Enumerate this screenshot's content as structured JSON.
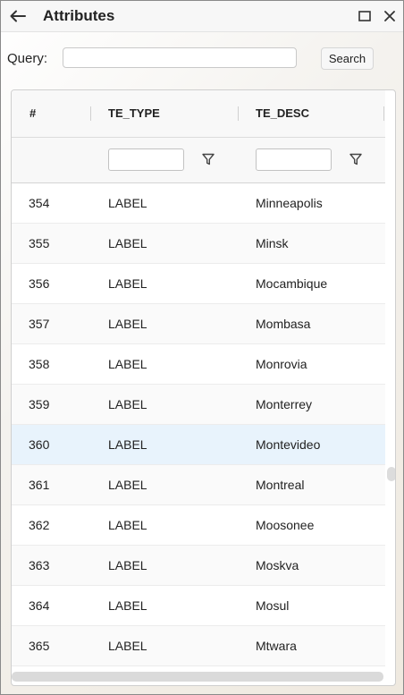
{
  "window": {
    "title": "Attributes",
    "icons": {
      "back": "arrow-left-icon",
      "maximize": "maximize-icon",
      "close": "close-icon"
    }
  },
  "query": {
    "label": "Query:",
    "value": "",
    "placeholder": "",
    "search_button": "Search"
  },
  "table": {
    "columns": [
      "#",
      "TE_TYPE",
      "TE_DESC"
    ],
    "filter_icon": "filter-icon",
    "rows": [
      {
        "num": "354",
        "type": "LABEL",
        "desc": "Minneapolis"
      },
      {
        "num": "355",
        "type": "LABEL",
        "desc": "Minsk"
      },
      {
        "num": "356",
        "type": "LABEL",
        "desc": "Mocambique"
      },
      {
        "num": "357",
        "type": "LABEL",
        "desc": "Mombasa"
      },
      {
        "num": "358",
        "type": "LABEL",
        "desc": "Monrovia"
      },
      {
        "num": "359",
        "type": "LABEL",
        "desc": "Monterrey"
      },
      {
        "num": "360",
        "type": "LABEL",
        "desc": "Montevideo",
        "selected": true
      },
      {
        "num": "361",
        "type": "LABEL",
        "desc": "Montreal"
      },
      {
        "num": "362",
        "type": "LABEL",
        "desc": "Moosonee"
      },
      {
        "num": "363",
        "type": "LABEL",
        "desc": "Moskva"
      },
      {
        "num": "364",
        "type": "LABEL",
        "desc": "Mosul"
      },
      {
        "num": "365",
        "type": "LABEL",
        "desc": "Mtwara"
      }
    ],
    "selected_row_color": "#e8f3fc"
  }
}
